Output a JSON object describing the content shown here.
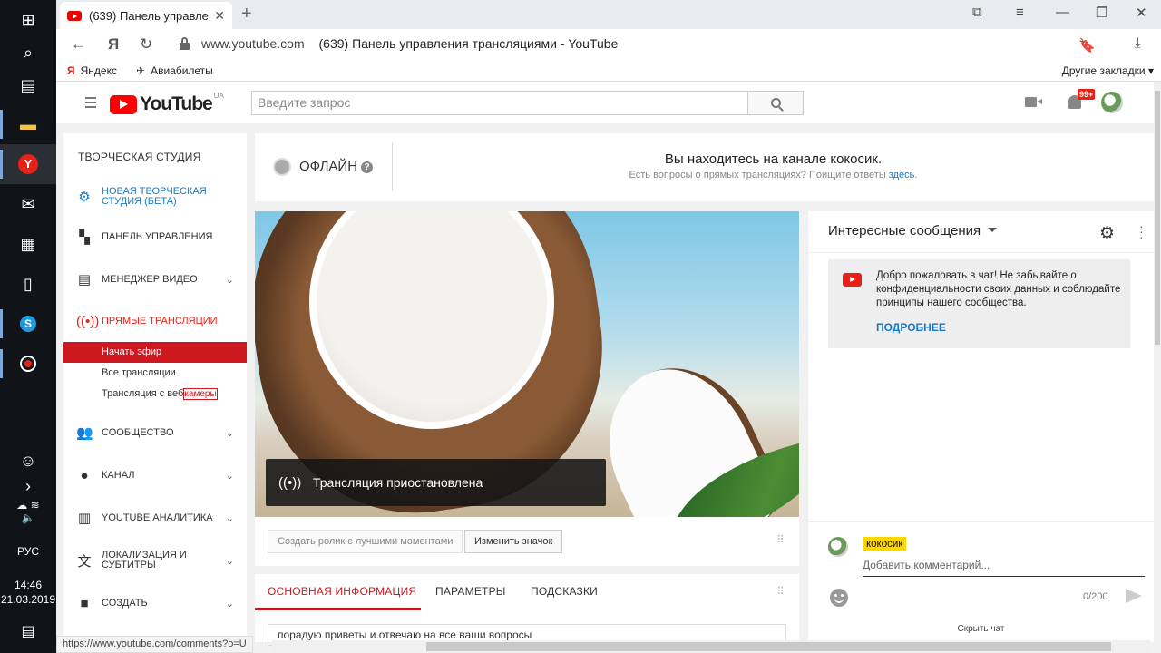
{
  "taskbar": {
    "apps": [
      "windows-start",
      "search",
      "task-view",
      "file-explorer",
      "yandex-browser",
      "mail",
      "store",
      "notepad",
      "skype",
      "screen-recorder"
    ],
    "clock_time": "14:46",
    "clock_date": "21.03.2019",
    "language": "РУС"
  },
  "browser": {
    "tab_title": "(639) Панель управления трансляциями - YouTube",
    "tab_title_short": "(639) Панель управлени",
    "url_domain": "www.youtube.com",
    "url_title": "(639) Панель управления трансляциями - YouTube",
    "bookmarks": [
      "Яндекс",
      "Авиабилеты"
    ],
    "other_bookmarks": "Другие закладки",
    "status_url": "https://www.youtube.com/comments?o=U"
  },
  "masthead": {
    "logo_text": "YouTube",
    "country": "UA",
    "search_placeholder": "Введите запрос",
    "notif_count": "99+"
  },
  "sidebar": {
    "title": "ТВОРЧЕСКАЯ СТУДИЯ",
    "items": [
      {
        "label": "НОВАЯ ТВОРЧЕСКАЯ СТУДИЯ (БЕТА)",
        "icon": "gear-icon"
      },
      {
        "label": "ПАНЕЛЬ УПРАВЛЕНИЯ",
        "icon": "dashboard-icon"
      },
      {
        "label": "МЕНЕДЖЕР ВИДЕО",
        "icon": "video-manager-icon"
      },
      {
        "label": "ПРЯМЫЕ ТРАНСЛЯЦИИ",
        "icon": "live-icon"
      },
      {
        "label": "СООБЩЕСТВО",
        "icon": "community-icon"
      },
      {
        "label": "КАНАЛ",
        "icon": "channel-icon"
      },
      {
        "label": "YOUTUBE АНАЛИТИКА",
        "icon": "analytics-icon"
      },
      {
        "label": "ЛОКАЛИЗАЦИЯ И СУБТИТРЫ",
        "icon": "translate-icon"
      },
      {
        "label": "СОЗДАТЬ",
        "icon": "create-icon"
      }
    ],
    "live_sub": [
      "Начать эфир",
      "Все трансляции",
      "Трансляция с веб",
      "камеры"
    ]
  },
  "status": {
    "state": "ОФЛАЙН",
    "title": "Вы находитесь на канале кокосик.",
    "subtitle": "Есть вопросы о прямых трансляциях? Поищите ответы",
    "link": "здесь",
    "period": "."
  },
  "video": {
    "banner": "Трансляция приостановлена",
    "highlights_button": "Создать ролик с лучшими моментами",
    "thumbnail_button": "Изменить значок"
  },
  "tabs": {
    "items": [
      "ОСНОВНАЯ ИНФОРМАЦИЯ",
      "ПАРАМЕТРЫ",
      "ПОДСКАЗКИ"
    ],
    "description": "порадую приветы и отвечаю на все ваши вопросы"
  },
  "chat": {
    "title": "Интересные сообщения",
    "welcome": "Добро пожаловать в чат! Не забывайте о конфиденциальности своих данных и соблюдайте принципы нашего сообщества.",
    "more": "ПОДРОБНЕЕ",
    "user_name": "кокосик",
    "input_placeholder": "Добавить комментарий...",
    "counter": "0/200",
    "hide": "Скрыть чат"
  }
}
